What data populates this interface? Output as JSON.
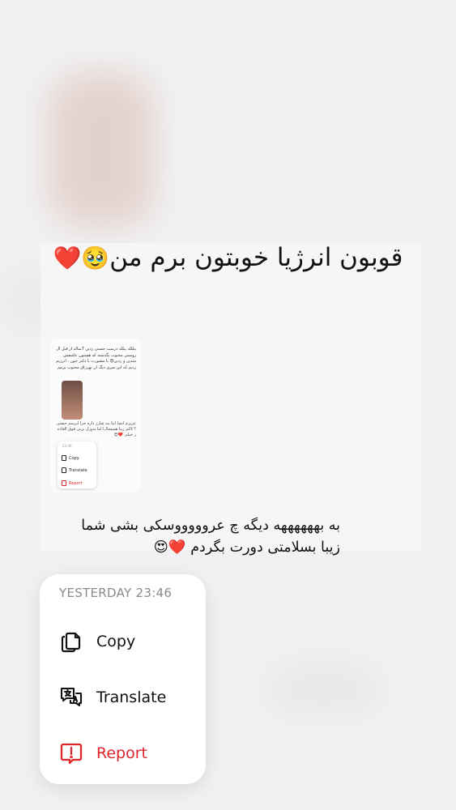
{
  "caption": {
    "text": "قوبون انرژیا خوبتون برم من",
    "emojis": "🥹❤️"
  },
  "thumbnail": {
    "post_text": "بیللله ییلله درست حسنی زدین 7ساله از قبل ال روستی محبوب بگذشته که هستون عاشقش شدین و زدین😍 با مشورت با دکتر جون ، انرژیم زدیم که این سری دیگ ان تهرراق محبوب بزنیم",
    "reply_text": "عزیزم انشا ایتا بنه شارژ داره جرا ابرسم حیفتی ؟ لاکم زیبا همیشال‌ا اما بدوزل بزنی فوق العاده ز خیلی ❤️😍",
    "menu": {
      "time": "23:46",
      "copy": "Copy",
      "translate": "Translate",
      "report": "Report"
    }
  },
  "comment": {
    "line1": "به بههههههه دیگه چ عروووووسکی بشی شما",
    "line2": "زیبا بسلامتی دورت بگردم",
    "emojis": "❤️😍"
  },
  "context_menu": {
    "timestamp": "YESTERDAY 23:46",
    "items": [
      {
        "label": "Copy",
        "icon": "copy-icon"
      },
      {
        "label": "Translate",
        "icon": "translate-icon"
      },
      {
        "label": "Report",
        "icon": "report-icon"
      }
    ],
    "report_color": "#e0252b"
  }
}
